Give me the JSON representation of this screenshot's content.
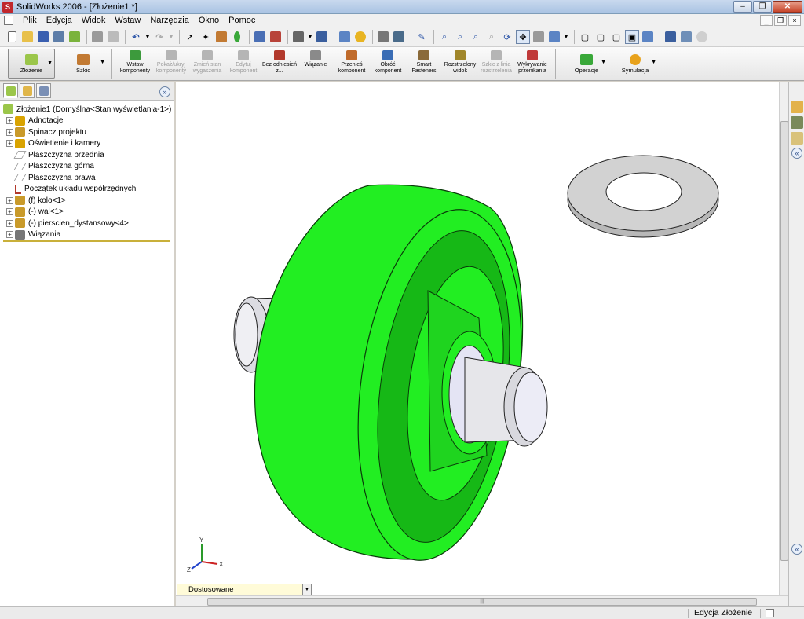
{
  "window": {
    "title": "SolidWorks 2006 - [Złożenie1 *]",
    "logo": "S"
  },
  "menu": [
    "Plik",
    "Edycja",
    "Widok",
    "Wstaw",
    "Narzędzia",
    "Okno",
    "Pomoc"
  ],
  "command_manager": {
    "assembly_label": "Złożenie",
    "sketch_label": "Szkic",
    "tools": [
      {
        "label": "Wstaw komponenty",
        "enabled": true,
        "color": "#3c9a3c"
      },
      {
        "label": "Pokaż/ukryj komponenty",
        "enabled": false,
        "color": "#b5b5b5"
      },
      {
        "label": "Zmień stan wygaszenia",
        "enabled": false,
        "color": "#b5b5b5"
      },
      {
        "label": "Edytuj komponent",
        "enabled": false,
        "color": "#b5b5b5"
      },
      {
        "label": "Bez odniesień z...",
        "enabled": true,
        "color": "#b2392c"
      },
      {
        "label": "Wiązanie",
        "enabled": true,
        "color": "#8a8a8a"
      },
      {
        "label": "Przenieś komponent",
        "enabled": true,
        "color": "#c06b2b"
      },
      {
        "label": "Obróć komponent",
        "enabled": true,
        "color": "#3a6db5"
      },
      {
        "label": "Smart Fasteners",
        "enabled": true,
        "color": "#8a6a3a"
      },
      {
        "label": "Rozstrzelony widok",
        "enabled": true,
        "color": "#a0862a"
      },
      {
        "label": "Szkic z linią rozstrzelenia",
        "enabled": false,
        "color": "#b5b5b5"
      },
      {
        "label": "Wykrywanie przenikania",
        "enabled": true,
        "color": "#c03a3a"
      }
    ],
    "operations_label": "Operacje",
    "simulation_label": "Symulacja"
  },
  "feature_tree": {
    "root": "Złożenie1  (Domyślna<Stan wyświetlania-1>)",
    "items": [
      {
        "label": "Adnotacje",
        "expandable": true,
        "icon": "annotations-icon",
        "color": "#d9a300"
      },
      {
        "label": "Spinacz projektu",
        "expandable": true,
        "icon": "design-binder-icon",
        "color": "#c99a2a"
      },
      {
        "label": "Oświetlenie i kamery",
        "expandable": true,
        "icon": "lights-cameras-icon",
        "color": "#d9a300"
      },
      {
        "label": "Płaszczyzna przednia",
        "expandable": false,
        "icon": "plane-icon",
        "color": "#888888"
      },
      {
        "label": "Płaszczyzna górna",
        "expandable": false,
        "icon": "plane-icon",
        "color": "#888888"
      },
      {
        "label": "Płaszczyzna prawa",
        "expandable": false,
        "icon": "plane-icon",
        "color": "#888888"
      },
      {
        "label": "Początek układu współrzędnych",
        "expandable": false,
        "icon": "origin-icon",
        "color": "#b2392c"
      },
      {
        "label": "(f) kolo<1>",
        "expandable": true,
        "icon": "component-icon",
        "color": "#c99a2a"
      },
      {
        "label": "(-) wal<1>",
        "expandable": true,
        "icon": "component-icon",
        "color": "#c99a2a"
      },
      {
        "label": "(-) pierscien_dystansowy<4>",
        "expandable": true,
        "icon": "component-icon",
        "color": "#c99a2a"
      },
      {
        "label": "Wiązania",
        "expandable": true,
        "icon": "mates-icon",
        "color": "#777777"
      }
    ]
  },
  "configuration": {
    "value": "Dostosowane"
  },
  "status": {
    "text": "Edycja Złożenie"
  },
  "colors": {
    "wheel": "#22ee22",
    "wheel_dark": "#16b816",
    "shaft": "#e6e6ea",
    "washer": "#d2d2d2"
  },
  "axes": {
    "x": "X",
    "y": "Y",
    "z": "Z"
  }
}
